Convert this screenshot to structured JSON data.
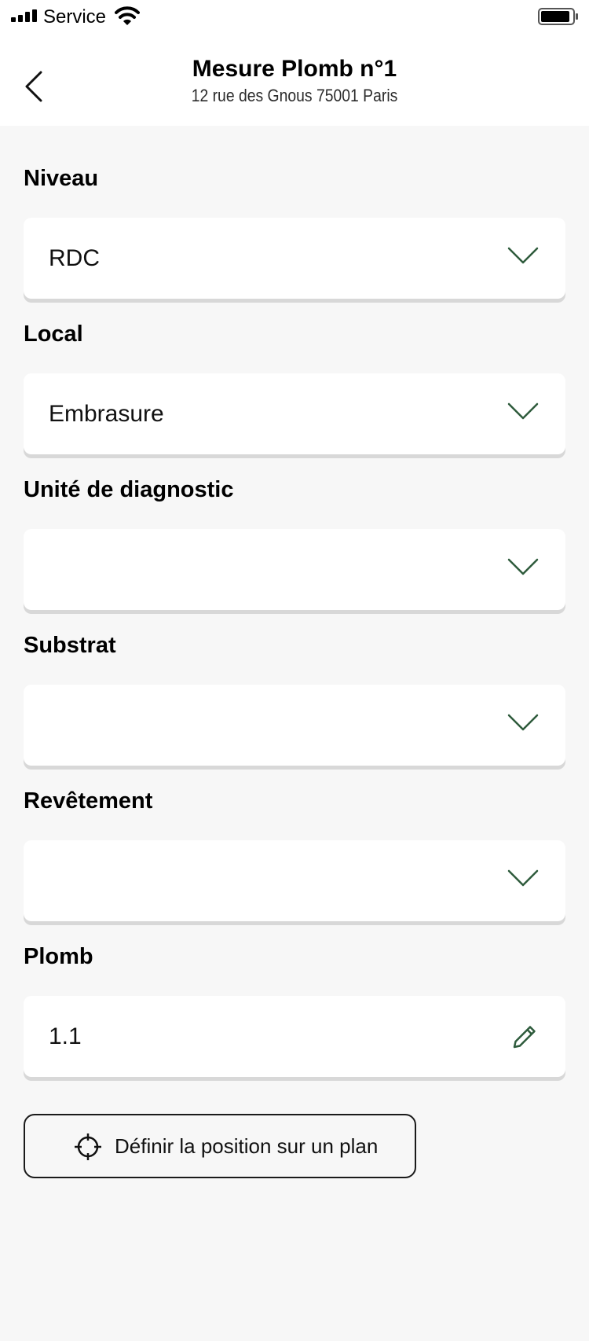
{
  "status_bar": {
    "carrier": "Service",
    "icons": [
      "signal-icon",
      "wifi-icon",
      "battery-icon"
    ]
  },
  "header": {
    "title": "Mesure Plomb n°1",
    "subtitle": "12 rue des Gnous 75001 Paris",
    "back_icon": "chevron-left-icon"
  },
  "fields": {
    "niveau": {
      "label": "Niveau",
      "value": "RDC"
    },
    "local": {
      "label": "Local",
      "value": "Embrasure"
    },
    "unite": {
      "label": "Unité de diagnostic",
      "value": ""
    },
    "substrat": {
      "label": "Substrat",
      "value": ""
    },
    "revetement": {
      "label": "Revêtement",
      "value": ""
    },
    "plomb": {
      "label": "Plomb",
      "value": "1.1"
    }
  },
  "position_button": {
    "label": "Définir la position sur un plan",
    "icon": "crosshair-icon"
  },
  "colors": {
    "accent": "#2e5b3c",
    "background": "#f7f7f7",
    "card": "#ffffff",
    "shadow": "#d8d8d8"
  }
}
